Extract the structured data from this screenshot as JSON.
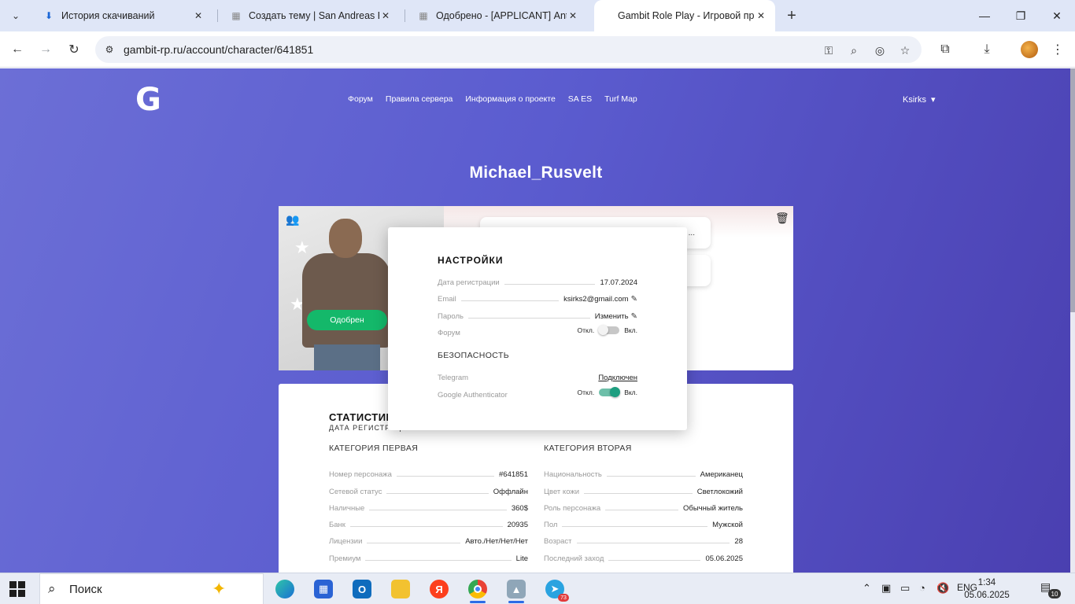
{
  "browser": {
    "tabs": [
      {
        "title": "История скачиваний",
        "icon": "download-icon"
      },
      {
        "title": "Создать тему | San Andreas Em",
        "icon": "forum-favicon"
      },
      {
        "title": "Одобрено - [APPLICANT] Anto",
        "icon": "forum-favicon"
      },
      {
        "title": "Gambit Role Play - Игровой пр",
        "icon": "gambit-favicon"
      }
    ],
    "url": "gambit-rp.ru/account/character/641851"
  },
  "site": {
    "logo_text": "G",
    "nav": [
      "Форум",
      "Правила сервера",
      "Информация о проекте",
      "SA ES",
      "Turf Map"
    ],
    "user": "Ksirks",
    "user_caret": "▾"
  },
  "character": {
    "name": "Michael_Rusvelt",
    "status_badge": "Одобрен",
    "chip1_text": "...",
    "chip2_text": ""
  },
  "stats": {
    "title": "СТАТИСТИК",
    "subtitle": "ДАТА РЕГИСТРАЦИИ 17.07.2024",
    "cat1": {
      "heading": "КАТЕГОРИЯ ПЕРВАЯ",
      "rows": [
        {
          "k": "Номер персонажа",
          "v": "#641851"
        },
        {
          "k": "Сетевой статус",
          "v": "Оффлайн"
        },
        {
          "k": "Наличные",
          "v": "360$"
        },
        {
          "k": "Банк",
          "v": "20935"
        },
        {
          "k": "Лицензии",
          "v": "Авто./Нет/Нет/Нет"
        },
        {
          "k": "Премиум",
          "v": "Lite"
        }
      ]
    },
    "cat2": {
      "heading": "КАТЕГОРИЯ ВТОРАЯ",
      "rows": [
        {
          "k": "Национальность",
          "v": "Американец"
        },
        {
          "k": "Цвет кожи",
          "v": "Светлокожий"
        },
        {
          "k": "Роль персонажа",
          "v": "Обычный житель"
        },
        {
          "k": "Пол",
          "v": "Мужской"
        },
        {
          "k": "Возраст",
          "v": "28"
        },
        {
          "k": "Последний заход",
          "v": "05.06.2025"
        }
      ]
    }
  },
  "settings": {
    "title": "НАСТРОЙКИ",
    "reg_label": "Дата регистрации",
    "reg_value": "17.07.2024",
    "email_label": "Email",
    "email_value": "ksirks2@gmail.com",
    "password_label": "Пароль",
    "password_value": "Изменить",
    "forum_label": "Форум",
    "off_label": "Откл.",
    "on_label": "Вкл.",
    "forum_enabled": false,
    "security_title": "БЕЗОПАСНОСТЬ",
    "telegram_label": "Telegram",
    "telegram_value": "Подключен",
    "ga_label": "Google Authenticator",
    "ga_enabled": true
  },
  "taskbar": {
    "search_placeholder": "Поиск",
    "apps": [
      "edge-icon",
      "store-icon",
      "outlook-icon",
      "explorer-icon",
      "yandex-icon",
      "chrome-icon",
      "gallery-icon",
      "telegram-icon"
    ],
    "telegram_badge": "73",
    "language": "ENG",
    "time": "1:34",
    "date": "05.06.2025",
    "notifications": "10",
    "yandex_letter": "Я",
    "outlook_letter": "O"
  },
  "colors": {
    "page_gradient_start": "#6c6fd6",
    "page_gradient_end": "#4a3fb0",
    "approved_green": "#14b86a",
    "toggle_on": "#1e9e80"
  }
}
